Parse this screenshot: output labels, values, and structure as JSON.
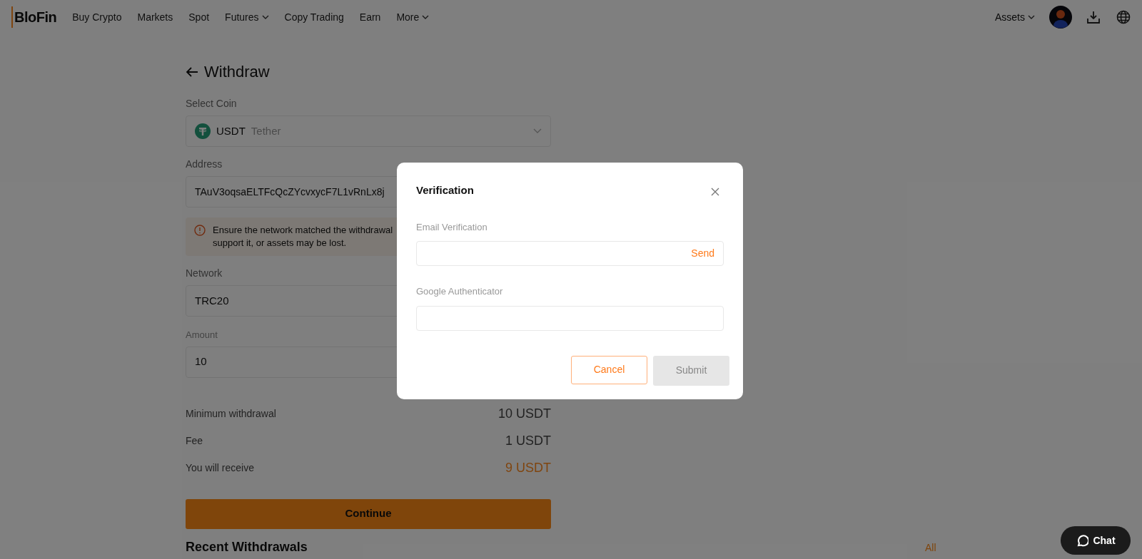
{
  "nav": {
    "logo": "BloFin",
    "items": [
      {
        "label": "Buy Crypto",
        "has_menu": false
      },
      {
        "label": "Markets",
        "has_menu": false
      },
      {
        "label": "Spot",
        "has_menu": false
      },
      {
        "label": "Futures",
        "has_menu": true
      },
      {
        "label": "Copy Trading",
        "has_menu": false
      },
      {
        "label": "Earn",
        "has_menu": false
      },
      {
        "label": "More",
        "has_menu": true
      }
    ],
    "assets": "Assets"
  },
  "withdraw": {
    "title": "Withdraw",
    "coin_label": "Select Coin",
    "coin_symbol": "USDT",
    "coin_name": "Tether",
    "address_label": "Address",
    "address": "TAuV3oqsaELTFcQcZYcvxycF7L1vRnLx8j",
    "warning_lines": [
      "Ensure the network matched the withdrawal",
      "support it, or assets may be lost."
    ],
    "network_label": "Network",
    "network": "TRC20",
    "amount_label": "Amount",
    "amount": "10",
    "summary": [
      {
        "label": "Minimum withdrawal",
        "value": "10 USDT",
        "highlight": false
      },
      {
        "label": "Fee",
        "value": "1 USDT",
        "highlight": false
      },
      {
        "label": "You will receive",
        "value": "9 USDT",
        "highlight": true
      }
    ],
    "continue": "Continue",
    "recent_title": "Recent Withdrawals",
    "recent_link": "All"
  },
  "dialog": {
    "title": "Verification",
    "email_label": "Email Verification",
    "send": "Send",
    "google_label": "Google Authenticator",
    "cancel": "Cancel",
    "submit": "Submit",
    "submit_disabled": true
  },
  "chat": "Chat"
}
